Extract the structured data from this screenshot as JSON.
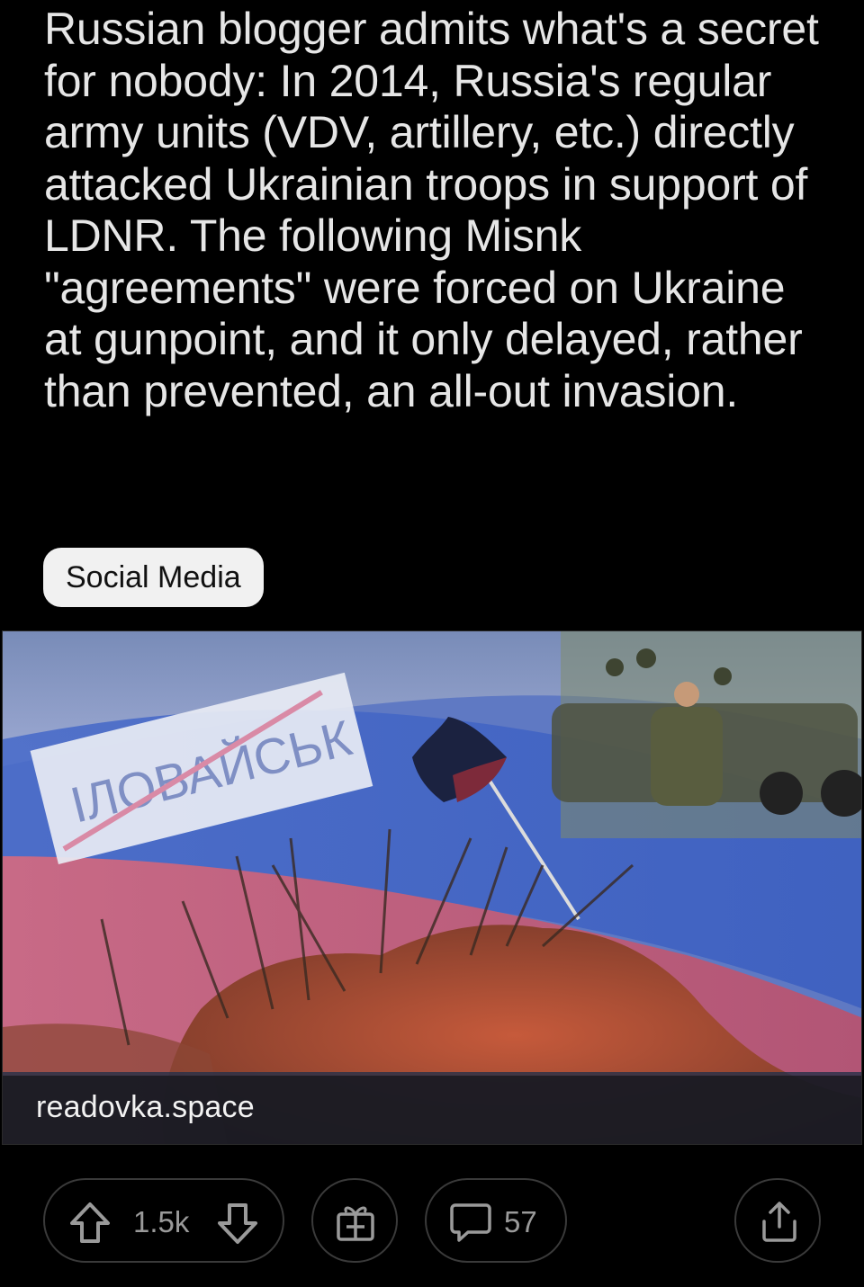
{
  "post": {
    "title": "Russian blogger admits what's a secret for nobody: In 2014, Russia's regular army units (VDV, artillery, etc.) directly attacked Ukrainian troops in support of LDNR. The following Misnk \"agreements\" were forced on Ukraine at gunpoint, and it only delayed, rather than prevented, an all-out invasion.",
    "flair": "Social Media"
  },
  "link_preview": {
    "domain": "readovka.space",
    "image_sign_text": "ІЛОВАЙСЬК"
  },
  "actions": {
    "upvote_icon": "arrow-up-icon",
    "downvote_icon": "arrow-down-icon",
    "score": "1.5k",
    "award_icon": "gift-icon",
    "comment_icon": "speech-bubble-icon",
    "comments": "57",
    "share_icon": "share-icon"
  },
  "colors": {
    "background": "#000000",
    "flair_bg": "#f1f1f1",
    "pill_border": "#3a3a3a",
    "muted_text": "#9a9a9a"
  }
}
